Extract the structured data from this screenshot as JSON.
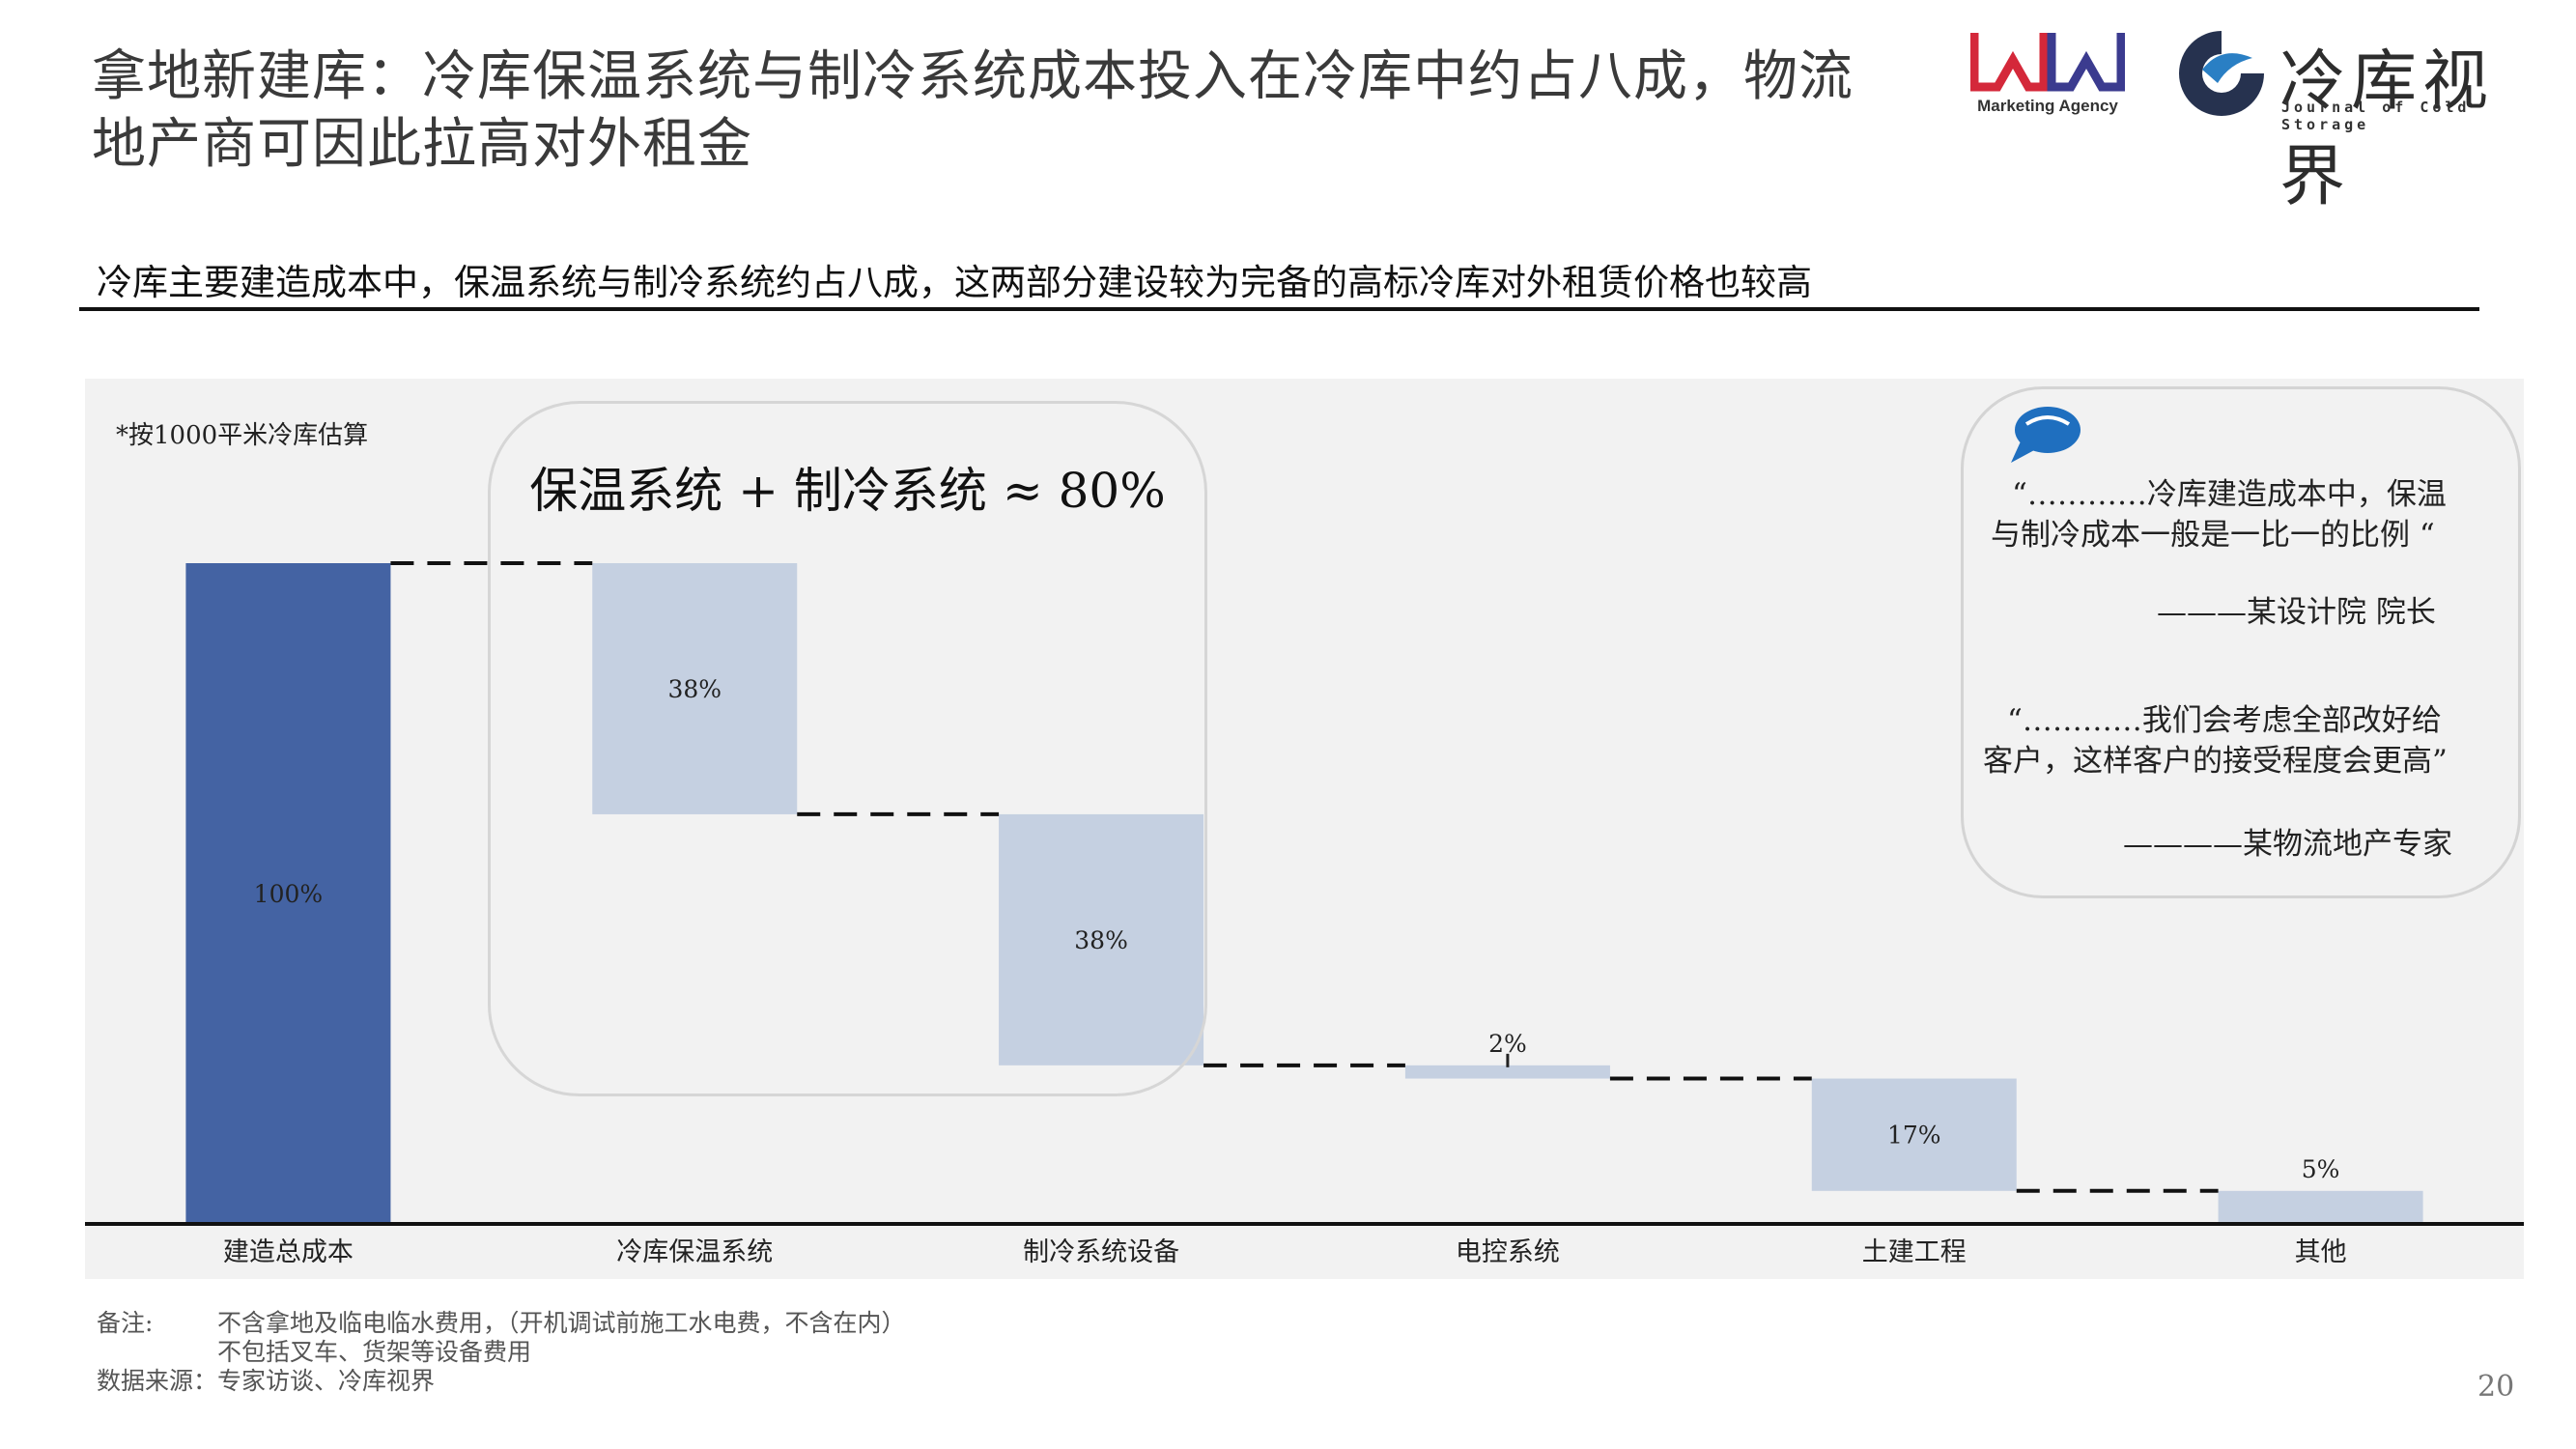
{
  "header": {
    "title": "拿地新建库：冷库保温系统与制冷系统成本投入在冷库中约占八成，物流地产商可因此拉高对外租金",
    "logo_ww_text": "Marketing Agency",
    "logo_cs_name": "冷库视界",
    "logo_cs_en": "Journal of Cold Storage"
  },
  "subtitle": "冷库主要建造成本中，保温系统与制冷系统约占八成，这两部分建设较为完备的高标冷库对外租赁价格也较高",
  "chart_note": "*按1000平米冷库估算",
  "group_label": "保温系统 + 制冷系统 ≈ 80%",
  "quotes": {
    "q1_line1": "“…………冷库建造成本中，保温",
    "q1_line2": "与制冷成本一般是一比一的比例 “",
    "q1_author": "———某设计院 院长",
    "q2_line1": "“…………我们会考虑全部改好给",
    "q2_line2": "客户，这样客户的接受程度会更高”",
    "q2_author": "————某物流地产专家"
  },
  "chart_data": {
    "type": "waterfall",
    "categories": [
      "建造总成本",
      "冷库保温系统",
      "制冷系统设备",
      "电控系统",
      "土建工程",
      "其他"
    ],
    "values": [
      100,
      38,
      38,
      2,
      17,
      5
    ],
    "labels": [
      "100%",
      "38%",
      "38%",
      "2%",
      "17%",
      "5%"
    ],
    "ylim": [
      0,
      100
    ],
    "colors": {
      "total": "#4463a3",
      "step": "#c5d0e1",
      "connector": "#111111",
      "axis": "#111111"
    }
  },
  "footer": {
    "note_label": "备注:",
    "note_line1": "不含拿地及临电临水费用，（开机调试前施工水电费，不含在内）",
    "note_line2": "不包括叉车、货架等设备费用",
    "source": "数据来源：专家访谈、冷库视界"
  },
  "page_number": "20"
}
